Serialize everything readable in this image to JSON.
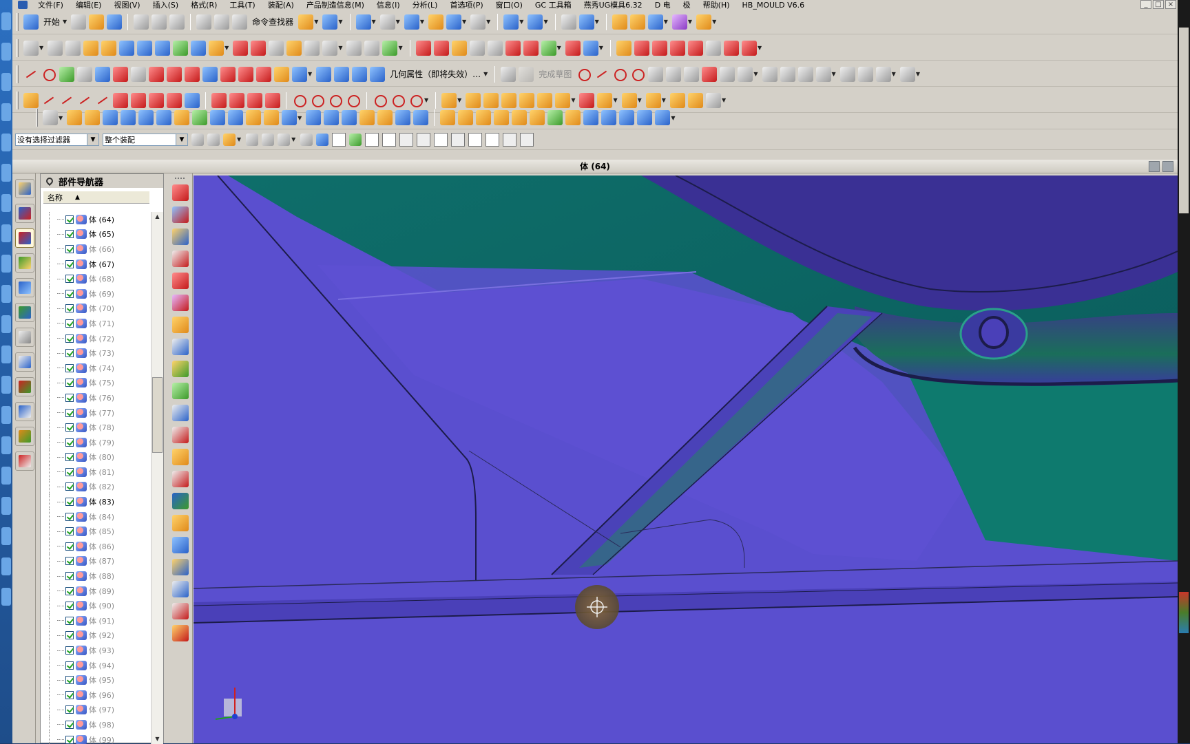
{
  "menubar": {
    "items": [
      "文件(F)",
      "编辑(E)",
      "视图(V)",
      "插入(S)",
      "格式(R)",
      "工具(T)",
      "装配(A)",
      "产品制造信息(M)",
      "信息(I)",
      "分析(L)",
      "首选项(P)",
      "窗口(O)",
      "GC 工具箱",
      "燕秀UG模具6.32",
      "D 电",
      "极",
      "帮助(H)",
      "HB_MOULD V6.6"
    ],
    "controls": [
      "_",
      "□",
      "×"
    ]
  },
  "toolbar1": {
    "start_label": "开始",
    "command_finder_label": "命令查找器"
  },
  "toolbar3": {
    "geom_props_label": "几何属性（即将失效）…",
    "finish_sketch_label": "完成草图"
  },
  "selection_bar": {
    "filter_value": "没有选择过滤器",
    "scope_value": "整个装配"
  },
  "graphics_window": {
    "title": "体 (64)"
  },
  "part_navigator": {
    "title": "部件导航器",
    "column_name": "名称",
    "rows": [
      {
        "label": "体 (64)",
        "gray": false
      },
      {
        "label": "体 (65)",
        "gray": false
      },
      {
        "label": "体 (66)",
        "gray": true
      },
      {
        "label": "体 (67)",
        "gray": false
      },
      {
        "label": "体 (68)",
        "gray": true
      },
      {
        "label": "体 (69)",
        "gray": true
      },
      {
        "label": "体 (70)",
        "gray": true
      },
      {
        "label": "体 (71)",
        "gray": true
      },
      {
        "label": "体 (72)",
        "gray": true
      },
      {
        "label": "体 (73)",
        "gray": true
      },
      {
        "label": "体 (74)",
        "gray": true
      },
      {
        "label": "体 (75)",
        "gray": true
      },
      {
        "label": "体 (76)",
        "gray": true
      },
      {
        "label": "体 (77)",
        "gray": true
      },
      {
        "label": "体 (78)",
        "gray": true
      },
      {
        "label": "体 (79)",
        "gray": true
      },
      {
        "label": "体 (80)",
        "gray": true
      },
      {
        "label": "体 (81)",
        "gray": true
      },
      {
        "label": "体 (82)",
        "gray": true
      },
      {
        "label": "体 (83)",
        "gray": false
      },
      {
        "label": "体 (84)",
        "gray": true
      },
      {
        "label": "体 (85)",
        "gray": true
      },
      {
        "label": "体 (86)",
        "gray": true
      },
      {
        "label": "体 (87)",
        "gray": true
      },
      {
        "label": "体 (88)",
        "gray": true
      },
      {
        "label": "体 (89)",
        "gray": true
      },
      {
        "label": "体 (90)",
        "gray": true
      },
      {
        "label": "体 (91)",
        "gray": true
      },
      {
        "label": "体 (92)",
        "gray": true
      },
      {
        "label": "体 (93)",
        "gray": true
      },
      {
        "label": "体 (94)",
        "gray": true
      },
      {
        "label": "体 (95)",
        "gray": true
      },
      {
        "label": "体 (96)",
        "gray": true
      },
      {
        "label": "体 (97)",
        "gray": true
      },
      {
        "label": "体 (98)",
        "gray": true
      },
      {
        "label": "体 (99)",
        "gray": true
      }
    ]
  },
  "colors": {
    "model_face": "#5a4fcf",
    "model_teal": "#0e6e6a",
    "model_green": "#1f8f6a",
    "edge_line": "#2a2a4a"
  }
}
